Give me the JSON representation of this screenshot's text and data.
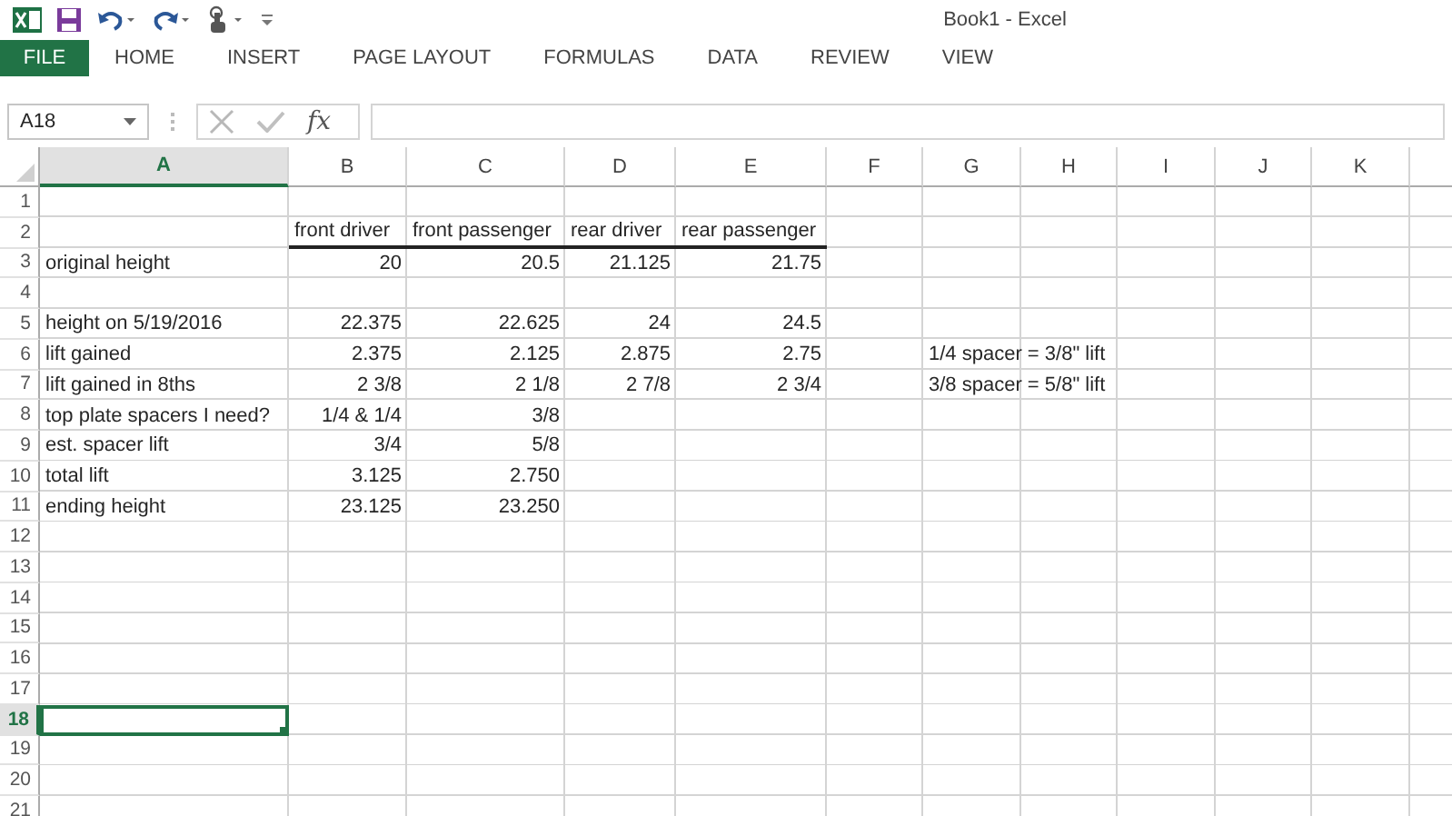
{
  "window": {
    "title": "Book1 - Excel"
  },
  "ribbon_tabs": [
    {
      "label": "FILE",
      "kind": "file"
    },
    {
      "label": "HOME",
      "kind": "tab"
    },
    {
      "label": "INSERT",
      "kind": "tab"
    },
    {
      "label": "PAGE LAYOUT",
      "kind": "tab"
    },
    {
      "label": "FORMULAS",
      "kind": "tab"
    },
    {
      "label": "DATA",
      "kind": "tab"
    },
    {
      "label": "REVIEW",
      "kind": "tab"
    },
    {
      "label": "VIEW",
      "kind": "tab"
    }
  ],
  "formula_bar": {
    "name_box": "A18",
    "function_label": "fx"
  },
  "columns": [
    {
      "label": "A",
      "selected": true
    },
    {
      "label": "B",
      "selected": false
    },
    {
      "label": "C",
      "selected": false
    },
    {
      "label": "D",
      "selected": false
    },
    {
      "label": "E",
      "selected": false
    },
    {
      "label": "F",
      "selected": false
    },
    {
      "label": "G",
      "selected": false
    },
    {
      "label": "H",
      "selected": false
    },
    {
      "label": "I",
      "selected": false
    },
    {
      "label": "J",
      "selected": false
    },
    {
      "label": "K",
      "selected": false
    }
  ],
  "rows": [
    {
      "label": "1",
      "selected": false,
      "underlined": false,
      "cells": {}
    },
    {
      "label": "2",
      "selected": false,
      "underlined": true,
      "cells": {
        "B": {
          "text": "front driver",
          "kind": "text"
        },
        "C": {
          "text": "front passenger",
          "kind": "text"
        },
        "D": {
          "text": "rear driver",
          "kind": "text"
        },
        "E": {
          "text": "rear passenger",
          "kind": "text"
        }
      }
    },
    {
      "label": "3",
      "selected": false,
      "underlined": false,
      "cells": {
        "A": {
          "text": "original height",
          "kind": "text"
        },
        "B": {
          "text": "20",
          "kind": "number"
        },
        "C": {
          "text": "20.5",
          "kind": "number"
        },
        "D": {
          "text": "21.125",
          "kind": "number"
        },
        "E": {
          "text": "21.75",
          "kind": "number"
        }
      }
    },
    {
      "label": "4",
      "selected": false,
      "underlined": false,
      "cells": {}
    },
    {
      "label": "5",
      "selected": false,
      "underlined": false,
      "cells": {
        "A": {
          "text": "height on 5/19/2016",
          "kind": "text"
        },
        "B": {
          "text": "22.375",
          "kind": "number"
        },
        "C": {
          "text": "22.625",
          "kind": "number"
        },
        "D": {
          "text": "24",
          "kind": "number"
        },
        "E": {
          "text": "24.5",
          "kind": "number"
        }
      }
    },
    {
      "label": "6",
      "selected": false,
      "underlined": false,
      "cells": {
        "A": {
          "text": "lift gained",
          "kind": "text"
        },
        "B": {
          "text": "2.375",
          "kind": "number"
        },
        "C": {
          "text": "2.125",
          "kind": "number"
        },
        "D": {
          "text": "2.875",
          "kind": "number"
        },
        "E": {
          "text": "2.75",
          "kind": "number"
        },
        "G": {
          "text": "1/4 spacer = 3/8\" lift",
          "kind": "text"
        }
      }
    },
    {
      "label": "7",
      "selected": false,
      "underlined": false,
      "cells": {
        "A": {
          "text": "lift gained in 8ths",
          "kind": "text"
        },
        "B": {
          "text": "2 3/8",
          "kind": "number"
        },
        "C": {
          "text": "2 1/8",
          "kind": "number"
        },
        "D": {
          "text": "2 7/8",
          "kind": "number"
        },
        "E": {
          "text": "2 3/4",
          "kind": "number"
        },
        "G": {
          "text": "3/8 spacer = 5/8\" lift",
          "kind": "text"
        }
      }
    },
    {
      "label": "8",
      "selected": false,
      "underlined": false,
      "cells": {
        "A": {
          "text": "top plate spacers I need?",
          "kind": "text"
        },
        "B": {
          "text": "1/4 & 1/4",
          "kind": "number"
        },
        "C": {
          "text": "3/8",
          "kind": "number"
        }
      }
    },
    {
      "label": "9",
      "selected": false,
      "underlined": false,
      "cells": {
        "A": {
          "text": "est. spacer lift",
          "kind": "text"
        },
        "B": {
          "text": "3/4",
          "kind": "number"
        },
        "C": {
          "text": "5/8",
          "kind": "number"
        }
      }
    },
    {
      "label": "10",
      "selected": false,
      "underlined": false,
      "cells": {
        "A": {
          "text": "total lift",
          "kind": "text"
        },
        "B": {
          "text": "3.125",
          "kind": "number"
        },
        "C": {
          "text": "2.750",
          "kind": "number"
        }
      }
    },
    {
      "label": "11",
      "selected": false,
      "underlined": false,
      "cells": {
        "A": {
          "text": "ending height",
          "kind": "text"
        },
        "B": {
          "text": "23.125",
          "kind": "number"
        },
        "C": {
          "text": "23.250",
          "kind": "number"
        }
      }
    },
    {
      "label": "12",
      "selected": false,
      "underlined": false,
      "cells": {}
    },
    {
      "label": "13",
      "selected": false,
      "underlined": false,
      "cells": {}
    },
    {
      "label": "14",
      "selected": false,
      "underlined": false,
      "cells": {}
    },
    {
      "label": "15",
      "selected": false,
      "underlined": false,
      "cells": {}
    },
    {
      "label": "16",
      "selected": false,
      "underlined": false,
      "cells": {}
    },
    {
      "label": "17",
      "selected": false,
      "underlined": false,
      "cells": {}
    },
    {
      "label": "18",
      "selected": true,
      "underlined": false,
      "cells": {}
    },
    {
      "label": "19",
      "selected": false,
      "underlined": false,
      "cells": {}
    },
    {
      "label": "20",
      "selected": false,
      "underlined": false,
      "cells": {}
    },
    {
      "label": "21",
      "selected": false,
      "underlined": false,
      "cells": {}
    }
  ]
}
